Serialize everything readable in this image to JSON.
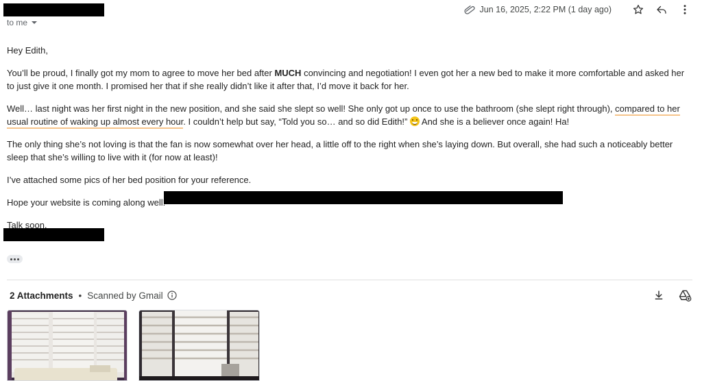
{
  "header": {
    "date": "Jun 16, 2025, 2:22 PM (1 day ago)",
    "to_me": "to me"
  },
  "message": {
    "greeting": "Hey Edith,",
    "p1_a": "You’ll be proud, I finally got my mom to agree to move her bed after ",
    "p1_bold": "MUCH",
    "p1_b": " convincing and negotiation! I even got her a new bed to make it more comfortable and asked her to just give it one month. I promised her that if she really didn’t like it after that, I’d move it back for her.",
    "p2_a": "Well… last night was her first night in the new position, and she said she slept so well! She only got up once to use the bathroom (she slept right through),",
    "p2_hl": "compared to her usual routine of waking up almost every hour",
    "p2_b": ". I couldn’t help but say, “Told you so… and so did Edith!”",
    "p2_c": " And she is a believer once again! Ha!",
    "p3": "The only thing she’s not loving is that the fan is now somewhat over her head, a little off to the right when she’s laying down. But overall, she had such a noticeably better sleep that she’s willing to live with it (for now at least)!",
    "p4": "I’ve attached some pics of her bed position for your reference.",
    "p5": "Hope your website is coming along well!",
    "signoff": "Talk soon,"
  },
  "attachments": {
    "count_label": "2 Attachments",
    "separator": "•",
    "scanned_label": "Scanned by Gmail"
  },
  "icons": {
    "clip": "paperclip-icon",
    "star": "star-icon",
    "reply": "reply-icon",
    "more": "more-vert-icon",
    "info": "info-icon",
    "download": "download-icon",
    "drive": "add-to-drive-icon",
    "emoji": "grinning-face-emoji"
  },
  "colors": {
    "highlight_underline": "#f6c48a",
    "redaction": "#000000"
  }
}
